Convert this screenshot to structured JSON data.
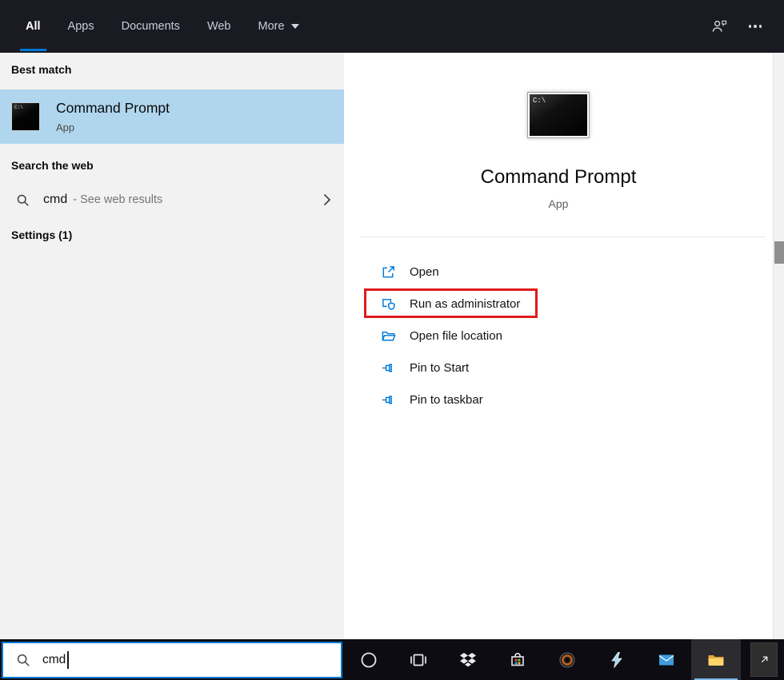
{
  "cmd_icon_text": "C:\\",
  "header": {
    "tabs": [
      {
        "label": "All",
        "active": true
      },
      {
        "label": "Apps",
        "active": false
      },
      {
        "label": "Documents",
        "active": false
      },
      {
        "label": "Web",
        "active": false
      },
      {
        "label": "More",
        "active": false,
        "has_dropdown": true
      }
    ],
    "right_icons": [
      "feedback-icon",
      "ellipsis-icon"
    ]
  },
  "left_panel": {
    "best_match_label": "Best match",
    "best_match": {
      "title": "Command Prompt",
      "subtitle": "App"
    },
    "web_label": "Search the web",
    "web": {
      "query": "cmd",
      "hint": "- See web results"
    },
    "settings_label": "Settings (1)"
  },
  "preview_panel": {
    "title": "Command Prompt",
    "subtitle": "App",
    "actions": [
      {
        "label": "Open",
        "icon": "open-icon",
        "highlighted": false
      },
      {
        "label": "Run as administrator",
        "icon": "admin-shield-icon",
        "highlighted": true
      },
      {
        "label": "Open file location",
        "icon": "folder-location-icon",
        "highlighted": false
      },
      {
        "label": "Pin to Start",
        "icon": "pin-icon",
        "highlighted": false
      },
      {
        "label": "Pin to taskbar",
        "icon": "pin-icon",
        "highlighted": false
      }
    ]
  },
  "taskbar": {
    "search_value": "cmd",
    "search_icon": "search-icon",
    "buttons": [
      "cortana",
      "task-view",
      "dropbox",
      "microsoft-store",
      "ring-app",
      "lightning-app",
      "mail",
      "file-explorer"
    ],
    "active_button": "file-explorer",
    "tray_icon": "tray-arrow-icon"
  },
  "colors": {
    "accent_blue": "#0078d7",
    "selection_blue": "#b0d6ee",
    "highlight_red": "#e01b1b",
    "header_bg": "#1a1a22",
    "taskbar_bg": "#0c0c12",
    "panel_left_bg": "#f2f2f2",
    "panel_right_bg": "#ffffff",
    "icon_blue": "#0078d7"
  }
}
